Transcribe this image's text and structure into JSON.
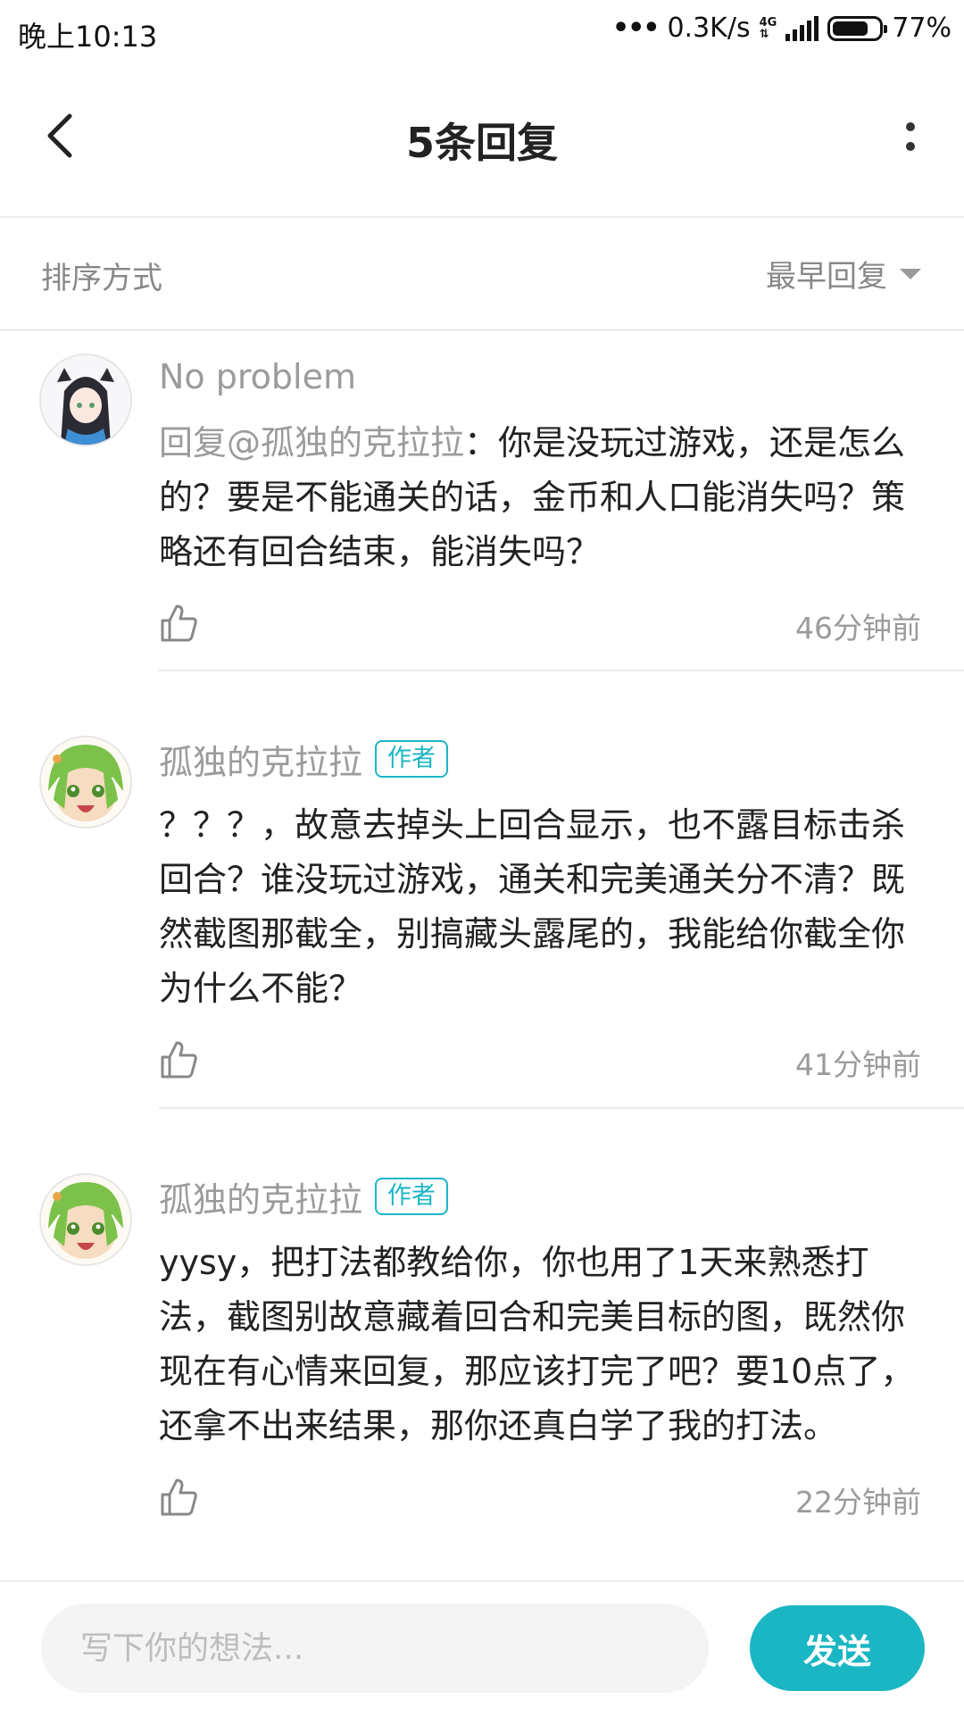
{
  "status_bar": {
    "time": "晚上10:13",
    "network_speed": "0.3K/s",
    "network_type": "4G",
    "battery": "77%",
    "battery_level": 0.77
  },
  "header": {
    "title": "5条回复",
    "back_icon": "chevron-left-icon",
    "more_icon": "more-vertical-icon"
  },
  "sort": {
    "label": "排序方式",
    "selected": "最早回复"
  },
  "comments": [
    {
      "name": "No problem",
      "badge": "",
      "mention": "回复@孤独的克拉拉",
      "text": "：你是没玩过游戏，还是怎么的？要是不能通关的话，金币和人口能消失吗？策略还有回合结束，能消失吗？",
      "time": "46分钟前"
    },
    {
      "name": "孤独的克拉拉",
      "badge": "作者",
      "text": "？？？，故意去掉头上回合显示，也不露目标击杀回合？谁没玩过游戏，通关和完美通关分不清？既然截图那截全，别搞藏头露尾的，我能给你截全你为什么不能？",
      "time": "41分钟前"
    },
    {
      "name": "孤独的克拉拉",
      "badge": "作者",
      "text": "yysy，把打法都教给你，你也用了1天来熟悉打法，截图别故意藏着回合和完美目标的图，既然你现在有心情来回复，那应该打完了吧？要10点了，还拿不出来结果，那你还真白学了我的打法。",
      "time": "22分钟前"
    }
  ],
  "composer": {
    "placeholder": "写下你的想法...",
    "send_label": "发送"
  },
  "colors": {
    "accent": "#1bb6c4",
    "muted_text": "#9b9b9b",
    "divider": "#ececec"
  }
}
